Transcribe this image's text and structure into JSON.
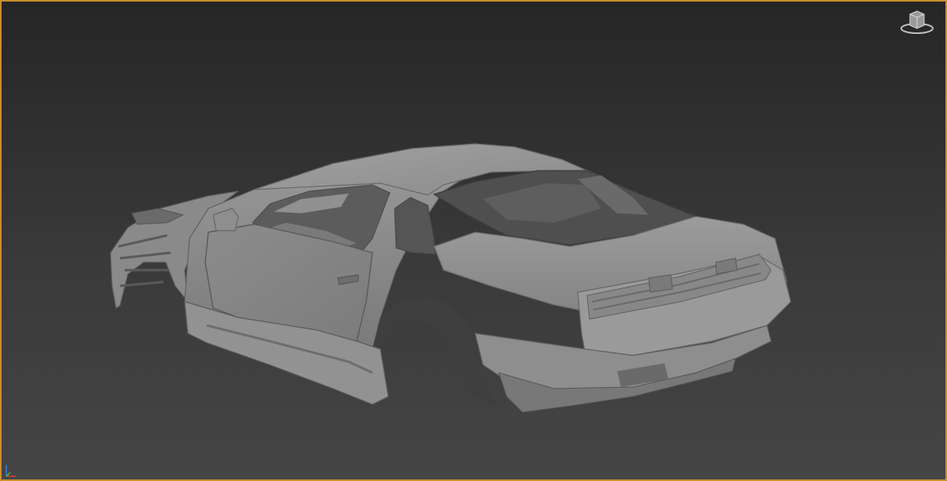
{
  "viewport": {
    "border_color": "#c8902a",
    "background_top": "#262626",
    "background_bottom": "#454545"
  },
  "viewcube": {
    "icon": "viewcube-icon"
  },
  "axis_gizmo": {
    "icon": "axis-tripod-icon"
  },
  "model": {
    "icon": "car-body-mesh",
    "shade_color": "#8e8e8e"
  }
}
